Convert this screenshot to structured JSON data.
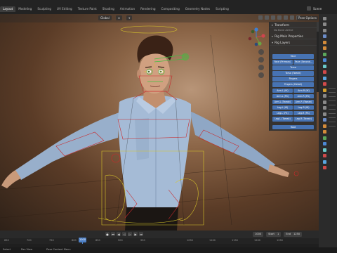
{
  "workspace_tabs": [
    "Layout",
    "Modeling",
    "Sculpting",
    "UV Editing",
    "Texture Paint",
    "Shading",
    "Animation",
    "Rendering",
    "Compositing",
    "Geometry Nodes",
    "Scripting"
  ],
  "active_tab_index": 0,
  "scene_label": "Scene",
  "viewport": {
    "orientation": "Global",
    "pose_options": "Pose Options"
  },
  "npanel": {
    "sections": {
      "transform": "Transform",
      "no_bone": "No Bone Active",
      "rig_main": "Rig Main Properties",
      "rig_layers": "Rig Layers"
    },
    "single_buttons": [
      "Face",
      "Torso",
      "Torso (Tweak)",
      "Fingers",
      "Fingers (Detail)"
    ],
    "face_row": [
      "Face (Primary)",
      "Face (Second..."
    ],
    "pair_rows": [
      [
        "Arm.L (IK)",
        "Arm.R (IK)"
      ],
      [
        "Arm.L (FK)",
        "Arm.R (FK)"
      ],
      [
        "Arm.L (Tweak)",
        "Arm.R (Tweak)"
      ],
      [
        "Leg.L (IK)",
        "Leg.R (IK)"
      ],
      [
        "Leg.L (FK)",
        "Leg.R (FK)"
      ],
      [
        "Leg.L (Tweak)",
        "Leg.R (Tweak)"
      ]
    ],
    "root": "Root",
    "vertical_tabs": [
      "Item",
      "Tool",
      "View",
      "Animation",
      "Edit"
    ]
  },
  "timeline": {
    "current_frame": "1000",
    "start_label": "Start",
    "start_value": "1",
    "end_label": "End",
    "end_value": "1250",
    "ruler": [
      "650",
      "700",
      "750",
      "800",
      "850",
      "900",
      "950",
      "1050",
      "1100",
      "1150",
      "1200",
      "1250"
    ]
  },
  "status": {
    "select": "Select",
    "pan": "Pan View",
    "menu": "Pose Context Menu"
  },
  "colors": {
    "accent_blue": "#4773b3",
    "playhead": "#4d7fc4",
    "bone_red": "#c9292b",
    "bone_yellow": "#d8c72a",
    "bone_green": "#3fbf3f"
  }
}
